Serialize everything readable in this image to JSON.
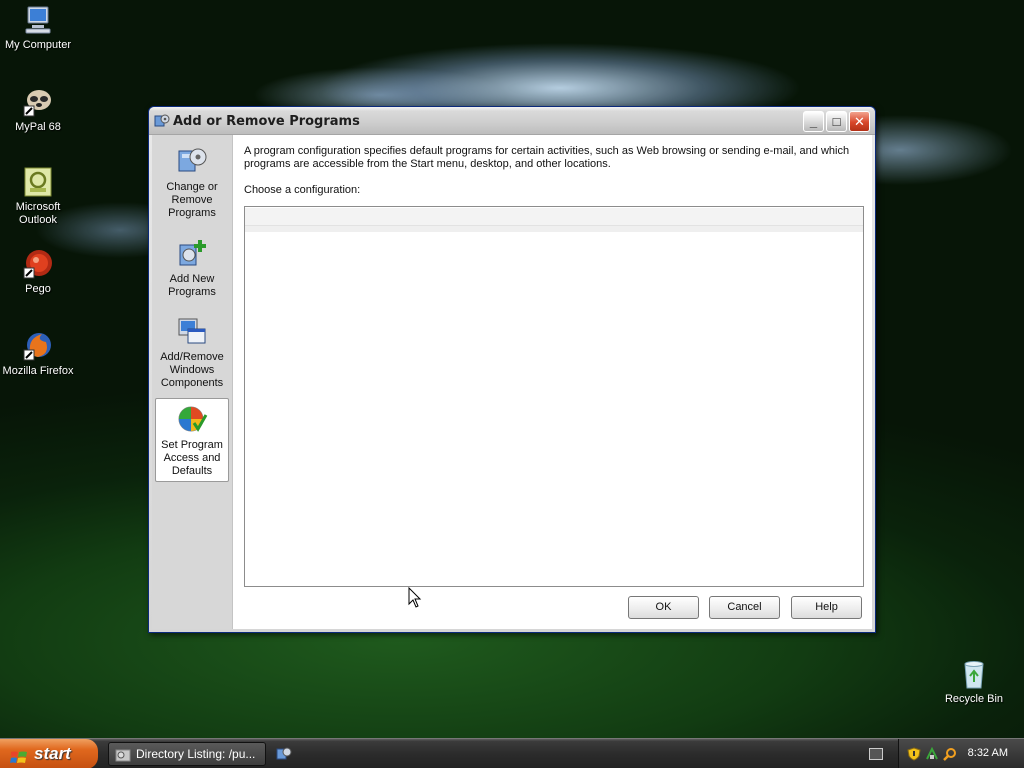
{
  "desktop": {
    "icons": [
      {
        "label": "My Computer",
        "icon": "my-computer-icon"
      },
      {
        "label": "MyPal 68",
        "icon": "mypal-icon"
      },
      {
        "label": "Microsoft Outlook",
        "icon": "outlook-icon"
      },
      {
        "label": "Pego",
        "icon": "pego-icon"
      },
      {
        "label": "Mozilla Firefox",
        "icon": "firefox-icon"
      },
      {
        "label": "Recycle Bin",
        "icon": "recycle-bin-icon"
      }
    ]
  },
  "window": {
    "title": "Add or Remove Programs",
    "controls": {
      "minimize": "_",
      "maximize": "□",
      "close": "✕"
    },
    "sidebar": [
      {
        "label": "Change or Remove Programs",
        "icon": "change-remove-programs-icon",
        "active": false
      },
      {
        "label": "Add New Programs",
        "icon": "add-new-programs-icon",
        "active": false
      },
      {
        "label": "Add/Remove Windows Components",
        "icon": "windows-components-icon",
        "active": false
      },
      {
        "label": "Set Program Access and Defaults",
        "icon": "program-access-defaults-icon",
        "active": true
      }
    ],
    "description": "A program configuration specifies default programs for certain activities, such as Web browsing or sending e-mail, and which programs are accessible from the Start menu, desktop, and other locations.",
    "choose_label": "Choose a configuration:",
    "buttons": {
      "ok": "OK",
      "cancel": "Cancel",
      "help": "Help"
    }
  },
  "taskbar": {
    "start_label": "start",
    "task_item": "Directory Listing: /pu...",
    "clock": "8:32 AM"
  },
  "colors": {
    "start_button": "#e0681e",
    "close_button": "#d8472a",
    "taskbar": "#2c2c2c"
  }
}
